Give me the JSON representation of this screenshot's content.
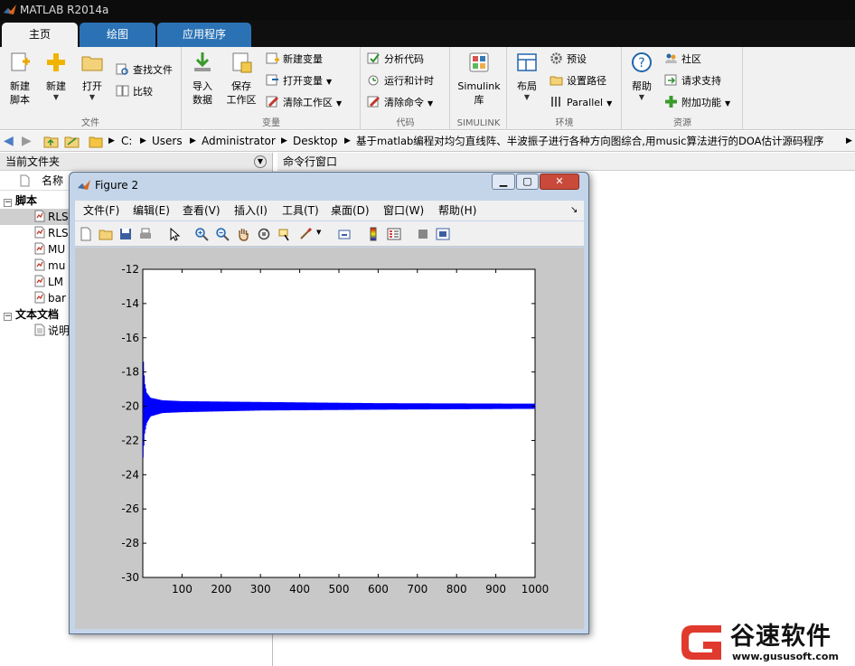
{
  "app": {
    "title": "MATLAB R2014a"
  },
  "tabs": [
    "主页",
    "绘图",
    "应用程序"
  ],
  "ribbon": {
    "file": {
      "label": "文件",
      "new_script": "新建\n脚本",
      "new": "新建",
      "open": "打开",
      "find_files": "查找文件",
      "compare": "比较"
    },
    "variable": {
      "label": "变量",
      "import": "导入\n数据",
      "save": "保存\n工作区",
      "new_var": "新建变量",
      "open_var": "打开变量",
      "clear_ws": "清除工作区"
    },
    "code": {
      "label": "代码",
      "analyze": "分析代码",
      "run_time": "运行和计时",
      "clear_cmd": "清除命令"
    },
    "simulink": {
      "label": "SIMULINK",
      "lib": "Simulink\n库"
    },
    "env": {
      "label": "环境",
      "layout": "布局",
      "prefs": "预设",
      "set_path": "设置路径",
      "parallel": "Parallel"
    },
    "resources": {
      "label": "资源",
      "help": "帮助",
      "community": "社区",
      "support": "请求支持",
      "addons": "附加功能"
    }
  },
  "address": {
    "crumbs": [
      "C:",
      "Users",
      "Administrator",
      "Desktop",
      "基于matlab编程对均匀直线阵、半波振子进行各种方向图综合,用music算法进行的DOA估计源码程序"
    ]
  },
  "left_panel": {
    "title": "当前文件夹",
    "col_name": "名称",
    "groups": [
      {
        "label": "脚本",
        "items": [
          "RLS",
          "RLS",
          "MU",
          "mu",
          "LM",
          "bar"
        ]
      },
      {
        "label": "文本文档",
        "items": [
          "说明"
        ]
      }
    ]
  },
  "right_panel": {
    "title": "命令行窗口"
  },
  "figure": {
    "title": "Figure 2",
    "menu": [
      "文件(F)",
      "编辑(E)",
      "查看(V)",
      "插入(I)",
      "工具(T)",
      "桌面(D)",
      "窗口(W)",
      "帮助(H)"
    ]
  },
  "chart_data": {
    "type": "line",
    "title": "",
    "xlabel": "",
    "ylabel": "",
    "xlim": [
      0,
      1000
    ],
    "ylim": [
      -30,
      -12
    ],
    "xticks": [
      100,
      200,
      300,
      400,
      500,
      600,
      700,
      800,
      900,
      1000
    ],
    "yticks": [
      -12,
      -14,
      -16,
      -18,
      -20,
      -22,
      -24,
      -26,
      -28,
      -30
    ],
    "series": [
      {
        "color": "#0000ff",
        "description_points": "oscillating learning curve converging to about -20",
        "envelope_upper": [
          [
            1,
            -17.0
          ],
          [
            5,
            -18.6
          ],
          [
            10,
            -19.2
          ],
          [
            20,
            -19.5
          ],
          [
            50,
            -19.65
          ],
          [
            100,
            -19.7
          ],
          [
            300,
            -19.75
          ],
          [
            600,
            -19.82
          ],
          [
            1000,
            -19.85
          ]
        ],
        "envelope_lower": [
          [
            1,
            -23.0
          ],
          [
            5,
            -21.6
          ],
          [
            10,
            -21.0
          ],
          [
            20,
            -20.6
          ],
          [
            50,
            -20.4
          ],
          [
            100,
            -20.35
          ],
          [
            300,
            -20.25
          ],
          [
            600,
            -20.2
          ],
          [
            1000,
            -20.15
          ]
        ]
      }
    ]
  },
  "watermark": {
    "brand": "谷速软件",
    "url": "www.gususoft.com"
  }
}
